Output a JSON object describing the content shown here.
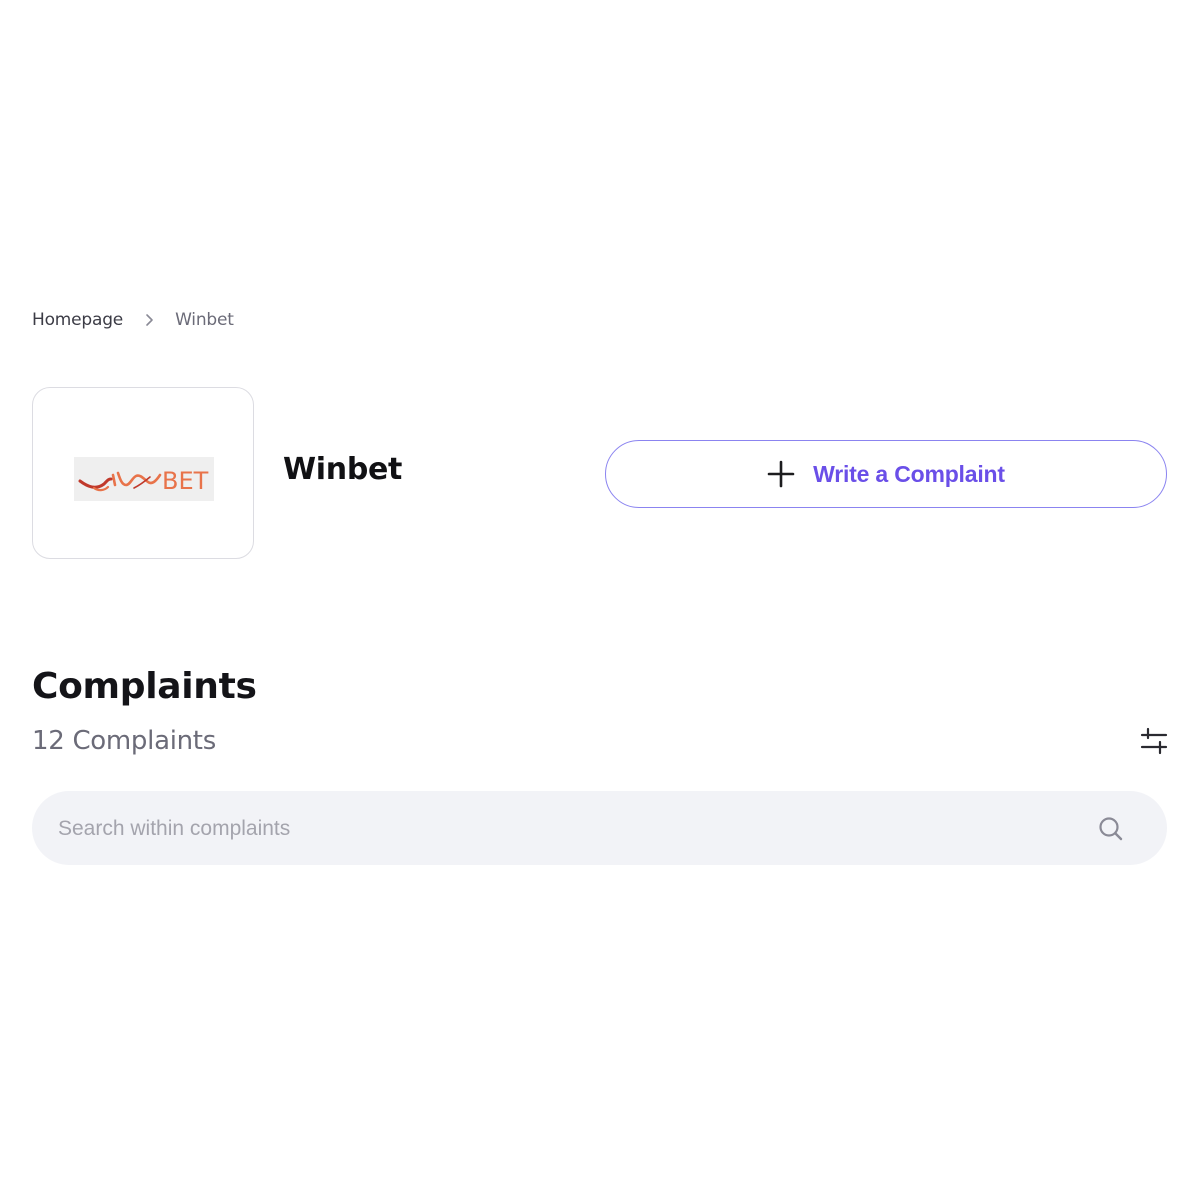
{
  "breadcrumb": {
    "home_label": "Homepage",
    "current_label": "Winbet",
    "separator_icon": "chevron-right-icon"
  },
  "company": {
    "name": "Winbet",
    "logo_text_script": "win",
    "logo_text_bet": "BET"
  },
  "actions": {
    "write_complaint_label": "Write a Complaint",
    "write_complaint_icon": "plus-icon"
  },
  "complaints": {
    "title": "Complaints",
    "count_label": "12 Complaints",
    "filter_icon": "filter-sliders-icon"
  },
  "search": {
    "placeholder": "Search within complaints",
    "value": "",
    "icon": "search-icon"
  },
  "colors": {
    "accent": "#6a4fe8",
    "button_border": "#8b84f0",
    "search_background": "#f2f3f7",
    "muted_text": "#6b6b78",
    "logo_orange": "#e8734a"
  }
}
